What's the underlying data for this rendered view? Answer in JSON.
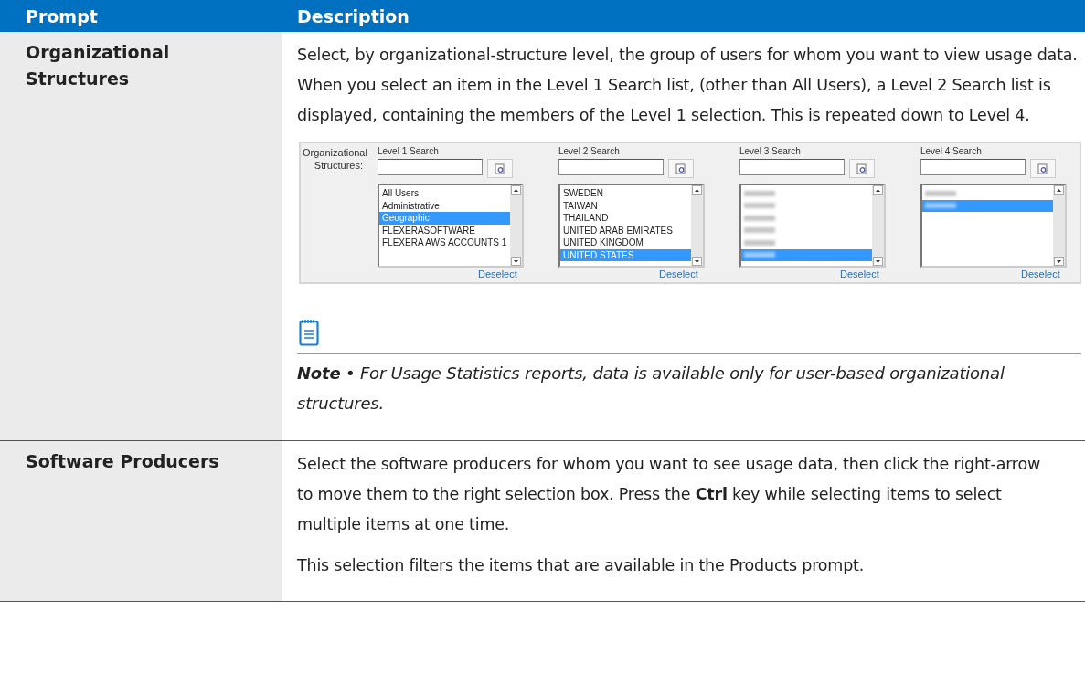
{
  "table": {
    "columns": [
      "Prompt",
      "Description"
    ],
    "rows": [
      {
        "prompt": "Organizational Structures",
        "paragraphs": [
          "Select, by organizational-structure level, the group of users for whom you want to view usage data. When you select an item in the Level 1 Search list, (other than All Users), a Level 2 Search list is displayed, containing the members of the Level 1 selection. This is repeated down to Level 4."
        ],
        "form": {
          "label": "Organizational Structures:",
          "levels": [
            {
              "title": "Level 1 Search",
              "link": "Deselect",
              "items": [
                {
                  "kind": "text",
                  "text": "All Users",
                  "selected": false
                },
                {
                  "kind": "text",
                  "text": "Administrative",
                  "selected": false
                },
                {
                  "kind": "text",
                  "text": "Geographic",
                  "selected": true
                },
                {
                  "kind": "text",
                  "text": "FLEXERASOFTWARE",
                  "selected": false
                },
                {
                  "kind": "text",
                  "text": "FLEXERA AWS ACCOUNTS 1",
                  "selected": false
                }
              ]
            },
            {
              "title": "Level 2 Search",
              "link": "Deselect",
              "items": [
                {
                  "kind": "text",
                  "text": "SWEDEN",
                  "selected": false
                },
                {
                  "kind": "text",
                  "text": "TAIWAN",
                  "selected": false
                },
                {
                  "kind": "text",
                  "text": "THAILAND",
                  "selected": false
                },
                {
                  "kind": "text",
                  "text": "UNITED ARAB EMIRATES",
                  "selected": false
                },
                {
                  "kind": "text",
                  "text": "UNITED KINGDOM",
                  "selected": false
                },
                {
                  "kind": "text",
                  "text": "UNITED STATES",
                  "selected": true
                }
              ]
            },
            {
              "title": "Level 3 Search",
              "link": "Deselect",
              "items": [
                {
                  "kind": "redacted",
                  "selected": false
                },
                {
                  "kind": "redacted",
                  "selected": false
                },
                {
                  "kind": "redacted",
                  "selected": false
                },
                {
                  "kind": "redacted",
                  "selected": false
                },
                {
                  "kind": "redacted",
                  "selected": false
                },
                {
                  "kind": "redacted",
                  "selected": true
                }
              ]
            },
            {
              "title": "Level 4 Search",
              "link": "Deselect",
              "items": [
                {
                  "kind": "redacted",
                  "selected": false
                },
                {
                  "kind": "redacted",
                  "selected": true
                }
              ]
            }
          ]
        },
        "note": "**Note** • For Usage Statistics reports, data is available only for user-based organizational structures."
      },
      {
        "prompt": "Software Producers",
        "paragraphs": [
          "Select the software producers for whom you want to see usage data, then click the right-arrow to move them to the right selection box. Press the **Ctrl** key while selecting items to select multiple items at one time.",
          "This selection filters the items that are available in the Products prompt."
        ]
      }
    ]
  }
}
